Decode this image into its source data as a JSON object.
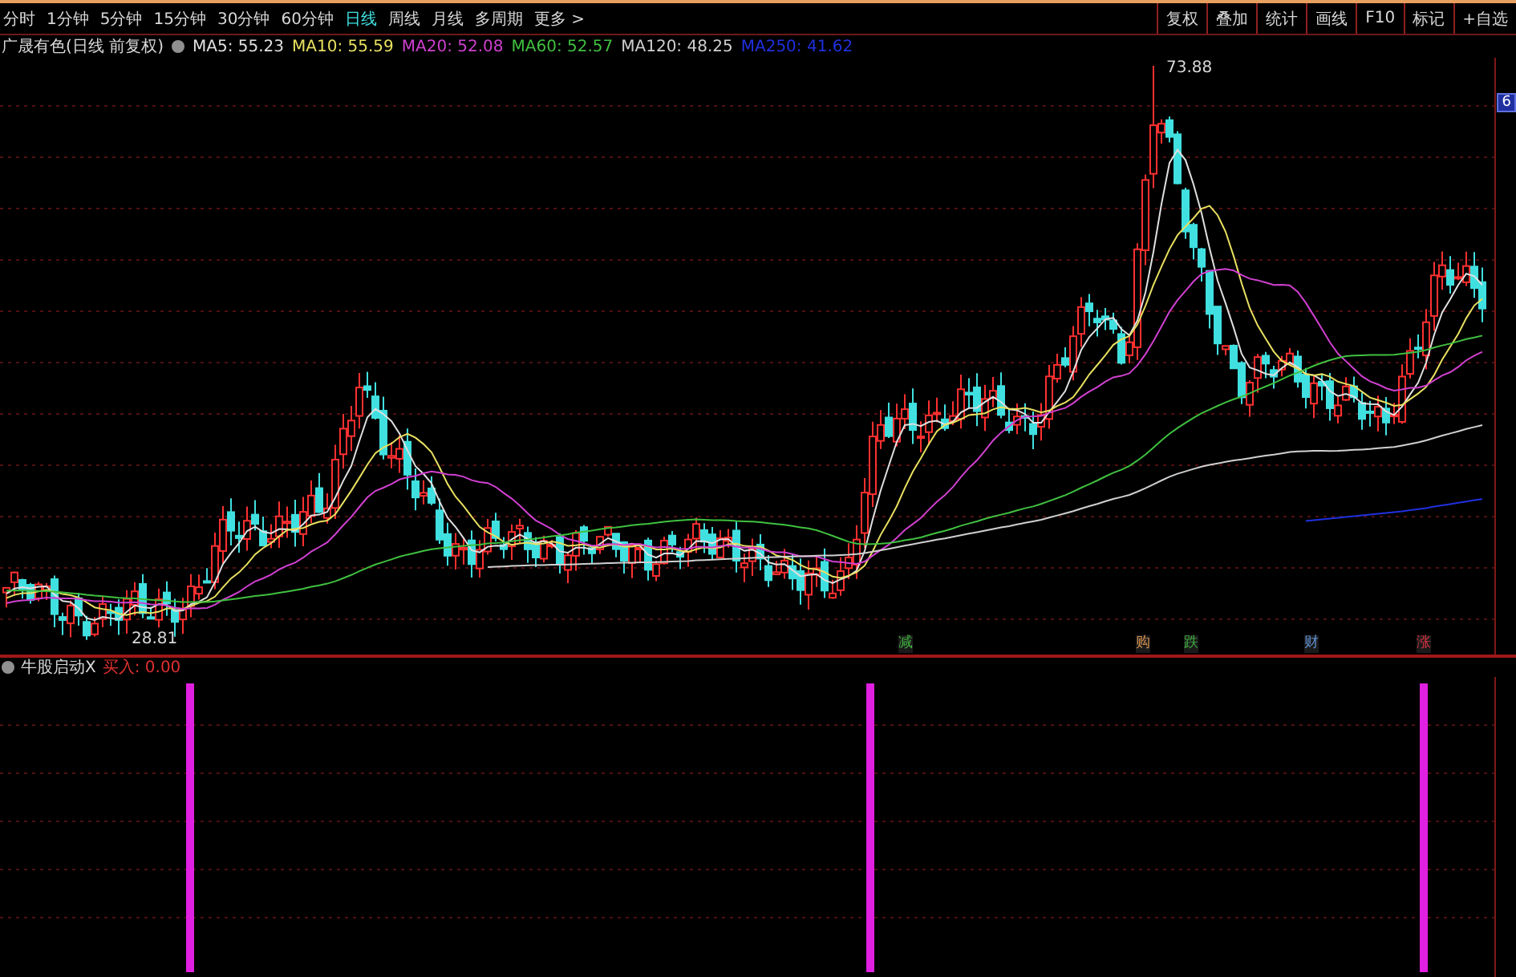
{
  "toolbar": {
    "periods": [
      {
        "label": "分时",
        "selected": false
      },
      {
        "label": "1分钟",
        "selected": false
      },
      {
        "label": "5分钟",
        "selected": false
      },
      {
        "label": "15分钟",
        "selected": false
      },
      {
        "label": "30分钟",
        "selected": false
      },
      {
        "label": "60分钟",
        "selected": false
      },
      {
        "label": "日线",
        "selected": true
      },
      {
        "label": "周线",
        "selected": false
      },
      {
        "label": "月线",
        "selected": false
      },
      {
        "label": "多周期",
        "selected": false
      },
      {
        "label": "更多 >",
        "selected": false
      }
    ],
    "buttons": [
      "复权",
      "叠加",
      "统计",
      "画线",
      "F10",
      "标记",
      "+自选"
    ]
  },
  "main_chart": {
    "title": "广晟有色(日线 前复权)",
    "moving_averages": [
      {
        "label": "MA5: 55.23",
        "color": "#e0e0e0"
      },
      {
        "label": "MA10: 55.59",
        "color": "#e8e060"
      },
      {
        "label": "MA20: 52.08",
        "color": "#d040d0"
      },
      {
        "label": "MA60: 52.57",
        "color": "#40c040"
      },
      {
        "label": "MA120: 48.25",
        "color": "#d0d0d0"
      },
      {
        "label": "MA250: 41.62",
        "color": "#2030e0"
      }
    ],
    "high_label": "73.88",
    "low_label": "28.81",
    "axis_label": "6",
    "signals": [
      {
        "text": "减",
        "color": "#40b040"
      },
      {
        "text": "购",
        "color": "#d09050"
      },
      {
        "text": "跌",
        "color": "#40b040"
      },
      {
        "text": "财",
        "color": "#6090d0"
      },
      {
        "text": "涨",
        "color": "#d03040"
      }
    ]
  },
  "indicator": {
    "name": "牛股启动X",
    "reading": "买入: 0.00"
  }
}
